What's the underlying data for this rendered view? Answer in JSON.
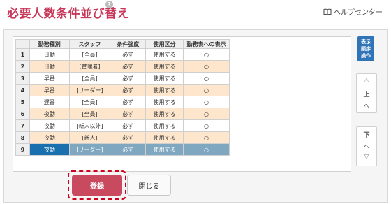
{
  "header": {
    "title": "必要人数条件並び替え",
    "help_mark": "?",
    "help_center_label": "ヘルプセンター"
  },
  "table": {
    "columns": [
      "勤務種別",
      "スタッフ",
      "条件強度",
      "使用区分",
      "勤務表への表示"
    ],
    "rows": [
      {
        "num": "1",
        "shift": "日勤",
        "staff": "[全員]",
        "strength": "必ず",
        "usage": "使用する",
        "display": "○"
      },
      {
        "num": "2",
        "shift": "日勤",
        "staff": "[管理者]",
        "strength": "必ず",
        "usage": "使用する",
        "display": "○"
      },
      {
        "num": "3",
        "shift": "早番",
        "staff": "[全員]",
        "strength": "必ず",
        "usage": "使用する",
        "display": "○"
      },
      {
        "num": "4",
        "shift": "早番",
        "staff": "[リーダー]",
        "strength": "必ず",
        "usage": "使用する",
        "display": "○"
      },
      {
        "num": "5",
        "shift": "遅番",
        "staff": "[全員]",
        "strength": "必ず",
        "usage": "使用する",
        "display": "○"
      },
      {
        "num": "6",
        "shift": "夜勤",
        "staff": "[全員]",
        "strength": "必ず",
        "usage": "使用する",
        "display": "○"
      },
      {
        "num": "7",
        "shift": "夜勤",
        "staff": "[新人以外]",
        "strength": "必ず",
        "usage": "使用する",
        "display": "○"
      },
      {
        "num": "8",
        "shift": "夜勤",
        "staff": "[新人]",
        "strength": "必ず",
        "usage": "使用する",
        "display": "○"
      },
      {
        "num": "9",
        "shift": "夜勤",
        "staff": "[リーダー]",
        "strength": "必ず",
        "usage": "使用する",
        "display": "○"
      }
    ],
    "selected_row": "9"
  },
  "side": {
    "display_order_lines": [
      "表示",
      "順序",
      "操作"
    ],
    "up_box": {
      "triangle": "△",
      "label": "上",
      "arrow": "へ"
    },
    "down_box": {
      "label": "下",
      "arrow": "へ",
      "triangle": "▽"
    }
  },
  "buttons": {
    "register": "登録",
    "close": "閉じる"
  },
  "colors": {
    "title": "#c8385a",
    "register_bg": "#c94a5f",
    "even_row": "#fde6cc",
    "selected_row": "#7fa8c0",
    "selected_first": "#1a6fae",
    "side_button": "#2f74b7",
    "highlight_border": "#d0021b"
  }
}
